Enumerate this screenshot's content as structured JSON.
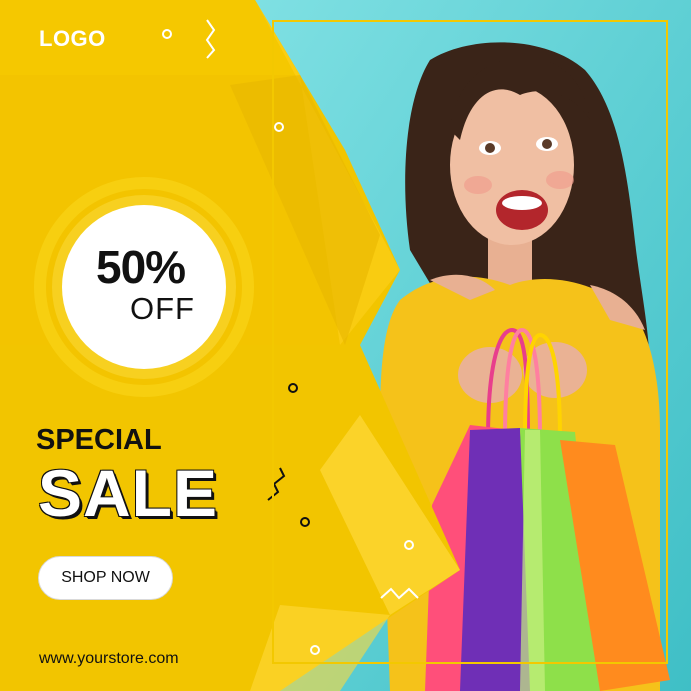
{
  "brand": {
    "logo_text": "LOGO"
  },
  "offer": {
    "percent": "50%",
    "off": "OFF"
  },
  "headline": {
    "line1": "SPECIAL",
    "line2": "SALE"
  },
  "cta": {
    "label": "SHOP NOW"
  },
  "footer": {
    "url": "www.yourstore.com"
  },
  "colors": {
    "yellow": "#f2c500",
    "yellow_dark": "#e7b800",
    "yellow_light": "#ffd624",
    "teal": "#58c9cf",
    "text": "#111111",
    "white": "#ffffff"
  }
}
